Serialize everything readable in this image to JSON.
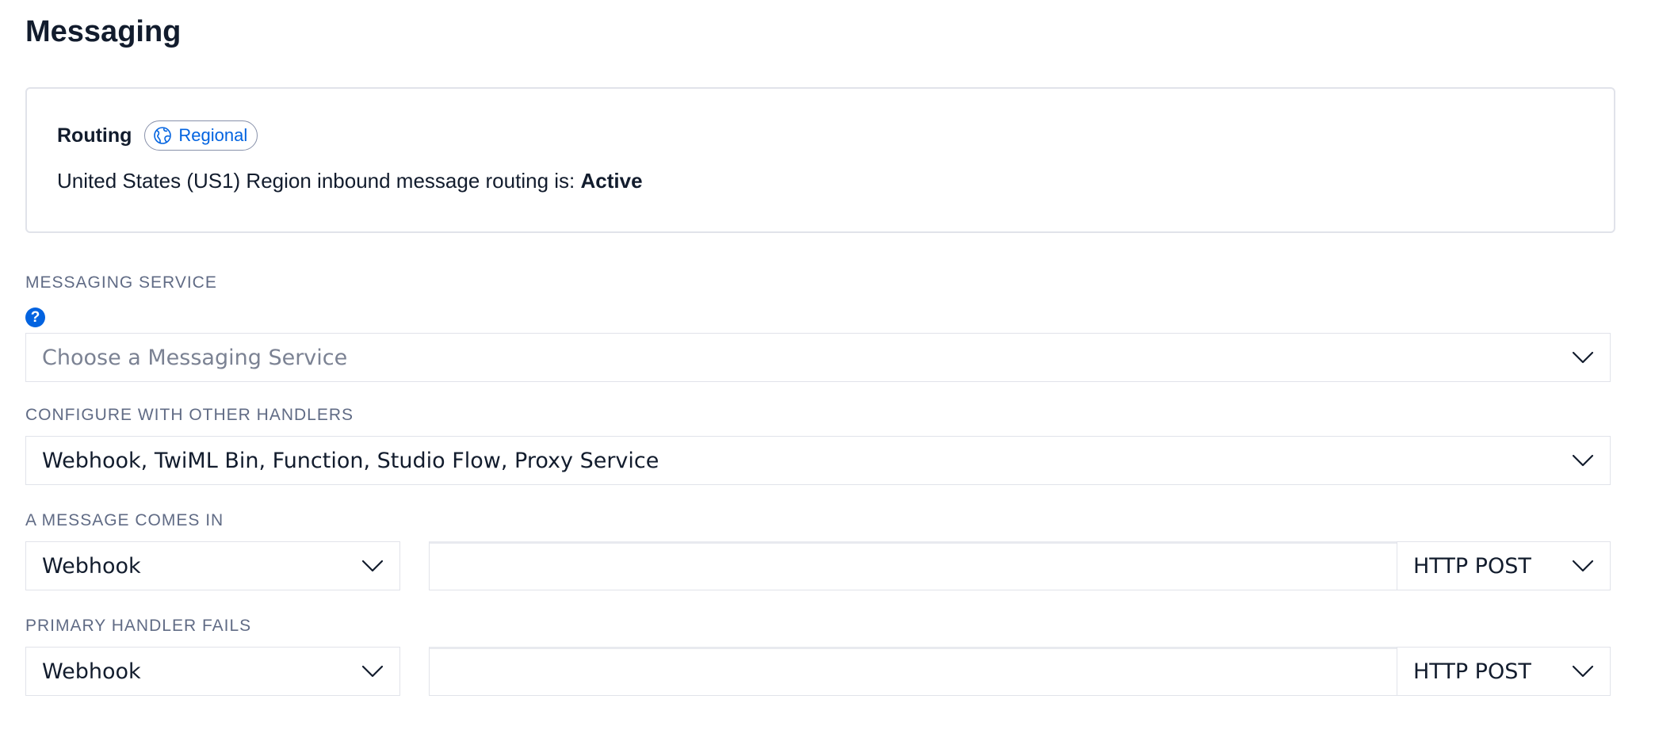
{
  "page": {
    "title": "Messaging"
  },
  "routing": {
    "title": "Routing",
    "badge_label": "Regional",
    "badge_icon": "globe-icon",
    "status_prefix": "United States (US1) Region inbound message routing is: ",
    "status_value": "Active"
  },
  "messaging_service": {
    "label": "MESSAGING SERVICE",
    "help_icon": "question-circle-icon",
    "placeholder": "Choose a Messaging Service"
  },
  "other_handlers": {
    "label": "CONFIGURE WITH OTHER HANDLERS",
    "value": "Webhook, TwiML Bin, Function, Studio Flow, Proxy Service"
  },
  "message_comes_in": {
    "label": "A MESSAGE COMES IN",
    "handler_type": "Webhook",
    "url_value": "",
    "method": "HTTP POST"
  },
  "primary_handler_fails": {
    "label": "PRIMARY HANDLER FAILS",
    "handler_type": "Webhook",
    "url_value": "",
    "method": "HTTP POST"
  },
  "colors": {
    "accent": "#0263e0",
    "text": "#121c2d",
    "label": "#606b85",
    "border": "#e1e3ea"
  }
}
